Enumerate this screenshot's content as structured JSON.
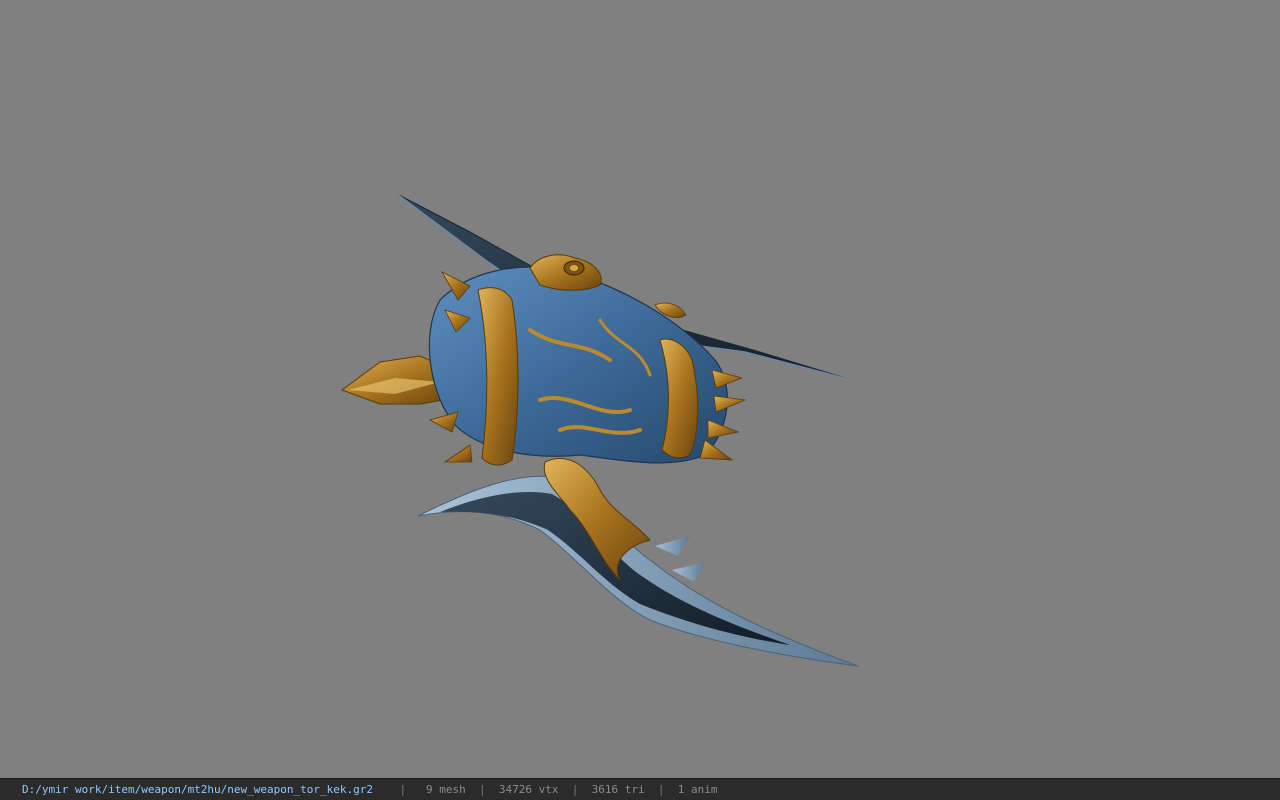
{
  "statusbar": {
    "file_path": "D:/ymir work/item/weapon/mt2hu/new_weapon_tor_kek.gr2",
    "mesh_count": "9 mesh",
    "vertex_count": "34726 vtx",
    "triangle_count": "3616 tri",
    "anim_count": "1 anim",
    "separator": "|"
  },
  "viewport": {
    "background_color": "#808080",
    "model_icon": "war-axe-model"
  }
}
